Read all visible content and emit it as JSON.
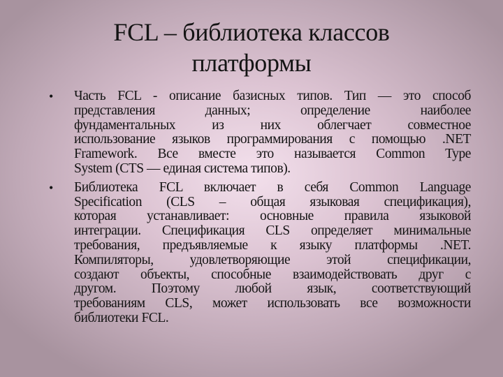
{
  "slide": {
    "title_line1": "FCL – библиотека классов",
    "title_line2": "платформы",
    "bullet_glyph": "•",
    "bullets": [
      {
        "lines": [
          "Часть FCL - описание базисных типов.  Тип — это способ",
          "представления данных; определение наиболее",
          "фундаментальных из них облегчает совместное",
          "использование языков программирования с помощью .NET",
          "Framework. Все вместе это называется Common Type",
          "System (CTS — единая система типов)."
        ]
      },
      {
        "lines": [
          "Библиотека FCL включает в себя Common Language",
          "Specification (CLS – общая языковая спецификация),",
          "которая устанавливает: основные правила языковой",
          "интеграции. Спецификация CLS определяет минимальные",
          "требования, предъявляемые к языку платформы .NET.",
          "Компиляторы, удовлетворяющие этой спецификации,",
          "создают объекты, способные взаимодействовать друг с",
          "другом. Поэтому любой язык, соответствующий",
          "требованиям CLS, может использовать все возможности",
          "библиотеки FCL."
        ]
      }
    ],
    "colors": {
      "background_center": "#f3e0ec",
      "background_edge": "#a8939f",
      "text": "#141414"
    }
  }
}
